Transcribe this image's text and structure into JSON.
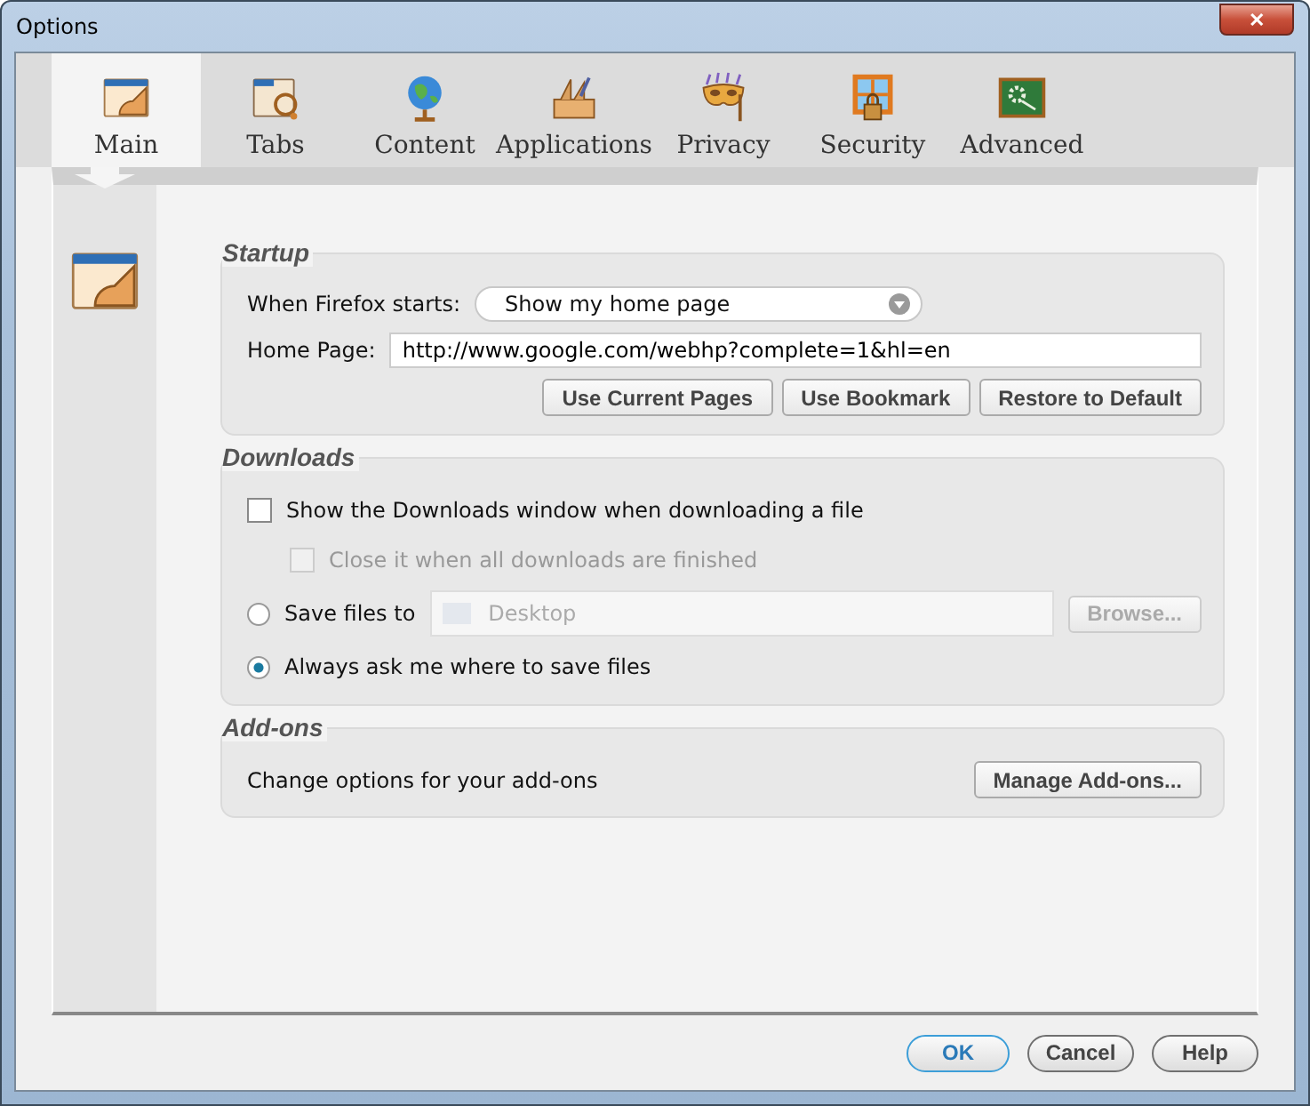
{
  "window": {
    "title": "Options",
    "close": "✕"
  },
  "tabs": [
    {
      "label": "Main",
      "kind": "main",
      "selected": true
    },
    {
      "label": "Tabs",
      "kind": "tabs",
      "selected": false
    },
    {
      "label": "Content",
      "kind": "content",
      "selected": false
    },
    {
      "label": "Applications",
      "kind": "applications",
      "selected": false
    },
    {
      "label": "Privacy",
      "kind": "privacy",
      "selected": false
    },
    {
      "label": "Security",
      "kind": "security",
      "selected": false
    },
    {
      "label": "Advanced",
      "kind": "advanced",
      "selected": false
    }
  ],
  "startup": {
    "title": "Startup",
    "when_label": "When Firefox starts:",
    "when_value": "Show my home page",
    "home_label": "Home Page:",
    "home_value": "http://www.google.com/webhp?complete=1&hl=en",
    "buttons": [
      "Use Current Pages",
      "Use Bookmark",
      "Restore to Default"
    ]
  },
  "downloads": {
    "title": "Downloads",
    "show_window": {
      "label": "Show the Downloads window when downloading a file",
      "checked": false,
      "disabled": false
    },
    "close_when_done": {
      "label": "Close it when all downloads are finished",
      "checked": false,
      "disabled": true
    },
    "save_to": {
      "label": "Save files to",
      "selected": false,
      "folder": "Desktop",
      "browse": "Browse...",
      "disabled": true
    },
    "always_ask": {
      "label": "Always ask me where to save files",
      "selected": true
    }
  },
  "addons": {
    "title": "Add-ons",
    "text": "Change options for your add-ons",
    "button": "Manage Add-ons..."
  },
  "buttons": [
    {
      "label": "OK",
      "default": true
    },
    {
      "label": "Cancel",
      "default": false
    },
    {
      "label": "Help",
      "default": false
    }
  ]
}
